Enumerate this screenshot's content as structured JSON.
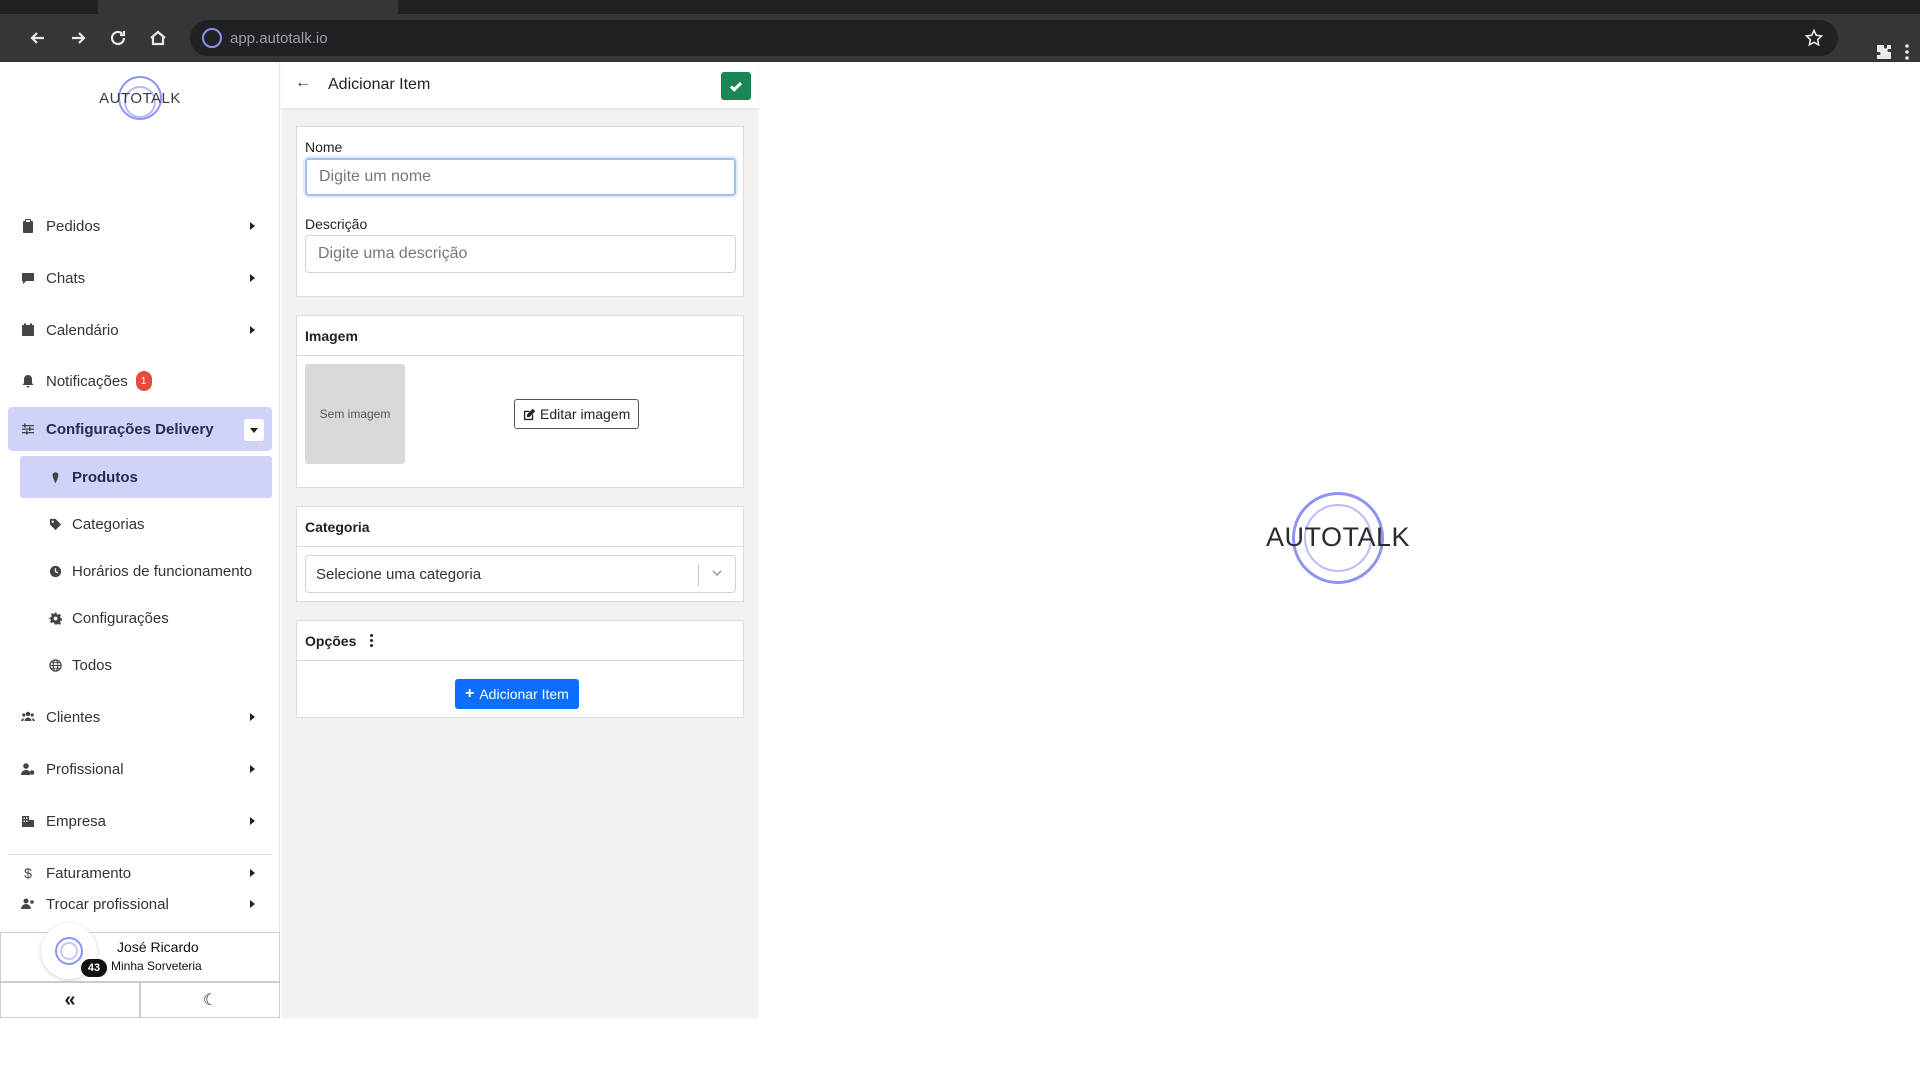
{
  "browser": {
    "url": "app.autotalk.io"
  },
  "brand": {
    "logo_text": "AUTOTALK",
    "accent_color": "#8f93f2"
  },
  "sidebar": {
    "items": [
      {
        "label": "Pedidos",
        "icon": "clipboard-icon"
      },
      {
        "label": "Chats",
        "icon": "comment-icon"
      },
      {
        "label": "Calendário",
        "icon": "calendar-icon"
      },
      {
        "label": "Notificações",
        "icon": "bell-icon",
        "badge": "1"
      },
      {
        "label": "Configurações Delivery",
        "icon": "sliders-icon",
        "active": true
      }
    ],
    "sub_items": [
      {
        "label": "Produtos",
        "icon": "ice-cream-icon",
        "active": true
      },
      {
        "label": "Categorias",
        "icon": "tag-icon"
      },
      {
        "label": "Horários de funcionamento",
        "icon": "clock-icon"
      },
      {
        "label": "Configurações",
        "icon": "gear-icon"
      },
      {
        "label": "Todos",
        "icon": "globe-icon"
      }
    ],
    "items_after": [
      {
        "label": "Clientes",
        "icon": "users-icon"
      },
      {
        "label": "Profissional",
        "icon": "user-gear-icon"
      },
      {
        "label": "Empresa",
        "icon": "building-icon"
      },
      {
        "label": "Faturamento",
        "icon": "dollar-icon"
      }
    ],
    "switch_professional": "Trocar profissional",
    "user": {
      "name": "José Ricardo",
      "company": "Minha Sorveteria",
      "badge": "43"
    },
    "collapse_glyph": "«",
    "dark_mode_glyph": "☾"
  },
  "form": {
    "title": "Adicionar Item",
    "name_label": "Nome",
    "name_placeholder": "Digite um nome",
    "description_label": "Descrição",
    "description_placeholder": "Digite uma descrição",
    "image_header": "Imagem",
    "no_image_text": "Sem imagem",
    "edit_image_label": "Editar imagem",
    "category_header": "Categoria",
    "category_placeholder": "Selecione uma categoria",
    "options_header": "Opções",
    "add_item_label": "Adicionar Item",
    "save_color": "#198754",
    "primary_color": "#0d6efd"
  }
}
